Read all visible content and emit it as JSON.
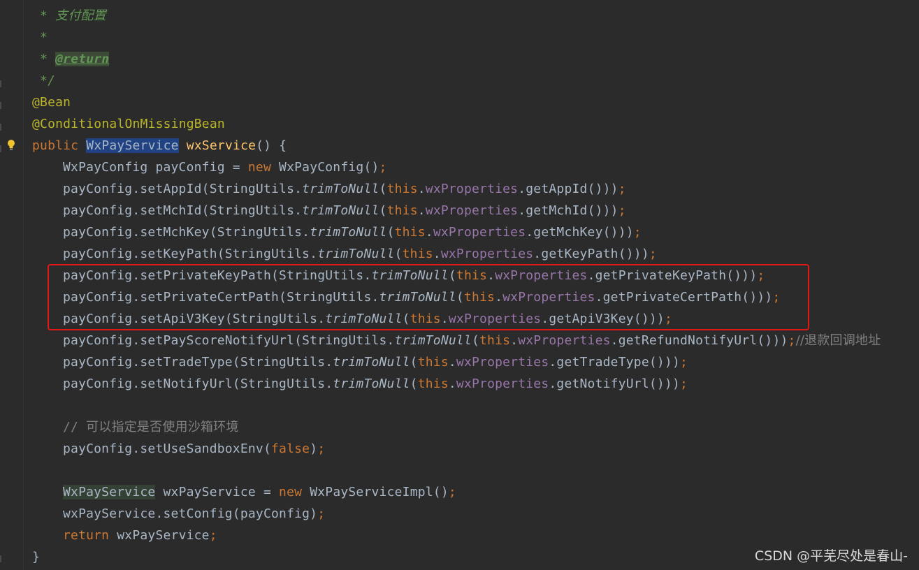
{
  "colors": {
    "background": "#2b2b2b",
    "keyword": "#cc7832",
    "method": "#ffc66d",
    "annotation": "#bbb529",
    "field": "#9876aa",
    "comment": "#808080",
    "doc_comment": "#629755",
    "highlight_box": "#e01818"
  },
  "gutter": {
    "icon": "lightbulb-icon"
  },
  "code": {
    "l1": {
      "star": "* ",
      "text": "支付配置"
    },
    "l2": {
      "star": "*"
    },
    "l3": {
      "star": "* ",
      "tag": "@return"
    },
    "l4": {
      "text": "*/"
    },
    "l5": {
      "text": "@Bean"
    },
    "l6": {
      "text": "@ConditionalOnMissingBean"
    },
    "l7": {
      "kw": "public",
      "type": "WxPayService",
      "name": "wxService",
      "rest": "() {"
    },
    "l8": {
      "a": "WxPayConfig payConfig = ",
      "kw": "new",
      "b": " WxPayConfig()",
      "semi": ";"
    },
    "calls": [
      {
        "pre": "payConfig.setAppId(StringUtils.",
        "static": "trimToNull",
        "open": "(",
        "kw": "this",
        "dot": ".",
        "field": "wxProperties",
        "post": ".getAppId()))",
        "semi": ";",
        "comment": ""
      },
      {
        "pre": "payConfig.setMchId(StringUtils.",
        "static": "trimToNull",
        "open": "(",
        "kw": "this",
        "dot": ".",
        "field": "wxProperties",
        "post": ".getMchId()))",
        "semi": ";",
        "comment": ""
      },
      {
        "pre": "payConfig.setMchKey(StringUtils.",
        "static": "trimToNull",
        "open": "(",
        "kw": "this",
        "dot": ".",
        "field": "wxProperties",
        "post": ".getMchKey()))",
        "semi": ";",
        "comment": ""
      },
      {
        "pre": "payConfig.setKeyPath(StringUtils.",
        "static": "trimToNull",
        "open": "(",
        "kw": "this",
        "dot": ".",
        "field": "wxProperties",
        "post": ".getKeyPath()))",
        "semi": ";",
        "comment": ""
      },
      {
        "pre": "payConfig.setPrivateKeyPath(StringUtils.",
        "static": "trimToNull",
        "open": "(",
        "kw": "this",
        "dot": ".",
        "field": "wxProperties",
        "post": ".getPrivateKeyPath()))",
        "semi": ";",
        "comment": ""
      },
      {
        "pre": "payConfig.setPrivateCertPath(StringUtils.",
        "static": "trimToNull",
        "open": "(",
        "kw": "this",
        "dot": ".",
        "field": "wxProperties",
        "post": ".getPrivateCertPath()))",
        "semi": ";",
        "comment": ""
      },
      {
        "pre": "payConfig.setApiV3Key(StringUtils.",
        "static": "trimToNull",
        "open": "(",
        "kw": "this",
        "dot": ".",
        "field": "wxProperties",
        "post": ".getApiV3Key()))",
        "semi": ";",
        "comment": ""
      },
      {
        "pre": "payConfig.setPayScoreNotifyUrl(StringUtils.",
        "static": "trimToNull",
        "open": "(",
        "kw": "this",
        "dot": ".",
        "field": "wxProperties",
        "post": ".getRefundNotifyUrl()))",
        "semi": ";",
        "comment": "//退款回调地址"
      },
      {
        "pre": "payConfig.setTradeType(StringUtils.",
        "static": "trimToNull",
        "open": "(",
        "kw": "this",
        "dot": ".",
        "field": "wxProperties",
        "post": ".getTradeType()))",
        "semi": ";",
        "comment": ""
      },
      {
        "pre": "payConfig.setNotifyUrl(StringUtils.",
        "static": "trimToNull",
        "open": "(",
        "kw": "this",
        "dot": ".",
        "field": "wxProperties",
        "post": ".getNotifyUrl()))",
        "semi": ";",
        "comment": ""
      }
    ],
    "l19": {
      "slashes": "// ",
      "text": "可以指定是否使用沙箱环境"
    },
    "l20": {
      "a": "payConfig.setUseSandboxEnv(",
      "kw": "false",
      "b": ")",
      "semi": ";"
    },
    "l22": {
      "type": "WxPayService",
      "a": " wxPayService = ",
      "kw": "new",
      "b": " WxPayServiceImpl()",
      "semi": ";"
    },
    "l23": {
      "a": "wxPayService.setConfig(payConfig)",
      "semi": ";"
    },
    "l24": {
      "kw": "return",
      "a": " wxPayService",
      "semi": ";"
    },
    "l25": {
      "text": "}"
    }
  },
  "watermark": "CSDN @平芜尽处是春山-"
}
